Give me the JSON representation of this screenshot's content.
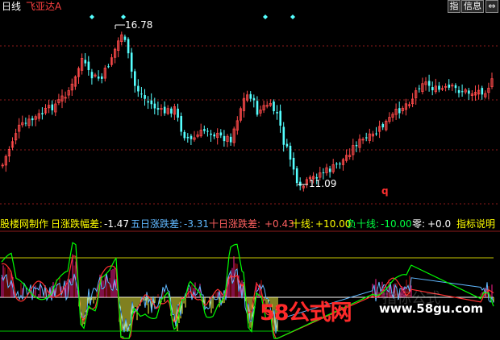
{
  "header": {
    "period": "日线",
    "stock_name": "飞亚达A",
    "btn_indicator": "指",
    "btn_info": "信息",
    "btn_arrow": "⇔"
  },
  "indicator_bar": {
    "author": "股楼网制作",
    "daily_label": "日涨跌幅差:",
    "daily_value": "-1.47",
    "five_label": "五日涨跌差:",
    "five_value": "-3.31",
    "ten_label": "十日涨跌差:",
    "ten_value": "+0.43",
    "upper_label": "十线:",
    "upper_value": "+10.00",
    "lower_label": "负十线:",
    "lower_value": "-10.00",
    "zero_label": "零:",
    "zero_value": "+0.0",
    "help": "指标说明"
  },
  "annotations": {
    "high_price": "16.78",
    "low_price": "11.09",
    "marker_q": "q"
  },
  "watermark": {
    "big": "58公式网",
    "url": "www.58gu.com",
    "ghost": "指标公式"
  },
  "colors": {
    "up": "#ff4a4a",
    "down": "#55ffff",
    "yellow": "#ffff00",
    "grid_red": "#8b1a1a",
    "upper_line": "#c8c800",
    "lower_line": "#00c800",
    "ten_line": "#00ff00",
    "five_line": "#ff3030",
    "daily_line": "#60b8ff",
    "hist_pos": "#ff2090",
    "hist_neg": "#ffff40",
    "brand_red": "#ff2a2a"
  }
}
